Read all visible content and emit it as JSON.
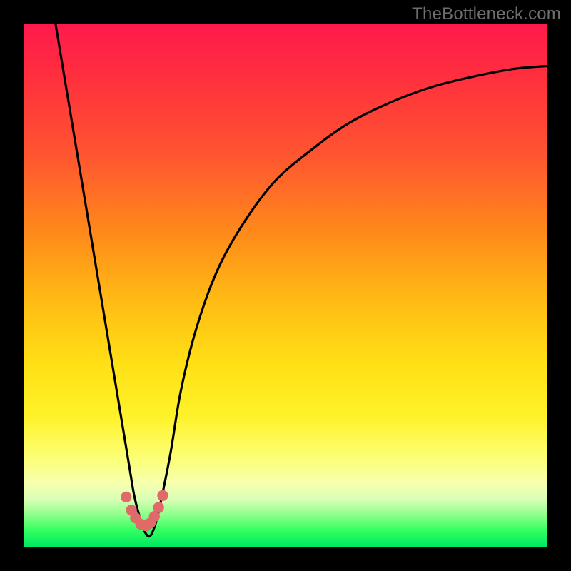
{
  "watermark": "TheBottleneck.com",
  "colors": {
    "frame": "#000000",
    "curve": "#000000",
    "dots": "#e06a6a",
    "gradient_top": "#ff1a4d",
    "gradient_bottom": "#00e862"
  },
  "chart_data": {
    "type": "line",
    "title": "",
    "xlabel": "",
    "ylabel": "",
    "xlim": [
      0,
      100
    ],
    "ylim": [
      0,
      100
    ],
    "grid": false,
    "legend": false,
    "note": "No numeric axis ticks are shown; x and y values are read off as 0–100% of the plot area (left→right, bottom→top).",
    "series": [
      {
        "name": "bottleneck-curve",
        "x": [
          6,
          8,
          10,
          12,
          14,
          16,
          18,
          20,
          21,
          22,
          23,
          24,
          25,
          26,
          28,
          30,
          33,
          37,
          42,
          48,
          55,
          62,
          70,
          78,
          86,
          94,
          100
        ],
        "y": [
          100,
          88,
          76,
          64,
          52,
          40,
          28,
          16,
          10,
          6,
          3,
          2,
          4,
          8,
          18,
          30,
          42,
          53,
          62,
          70,
          76,
          81,
          85,
          88,
          90,
          91.5,
          92
        ]
      }
    ],
    "marker_cluster": {
      "name": "sweet-spot-dots",
      "x": [
        19.5,
        20.5,
        21.3,
        22.3,
        23.3,
        24.1,
        24.9,
        25.7,
        26.5
      ],
      "y": [
        9.5,
        7.0,
        5.5,
        4.3,
        4.0,
        4.5,
        5.8,
        7.5,
        9.8
      ],
      "r_pct": 1.05
    }
  }
}
